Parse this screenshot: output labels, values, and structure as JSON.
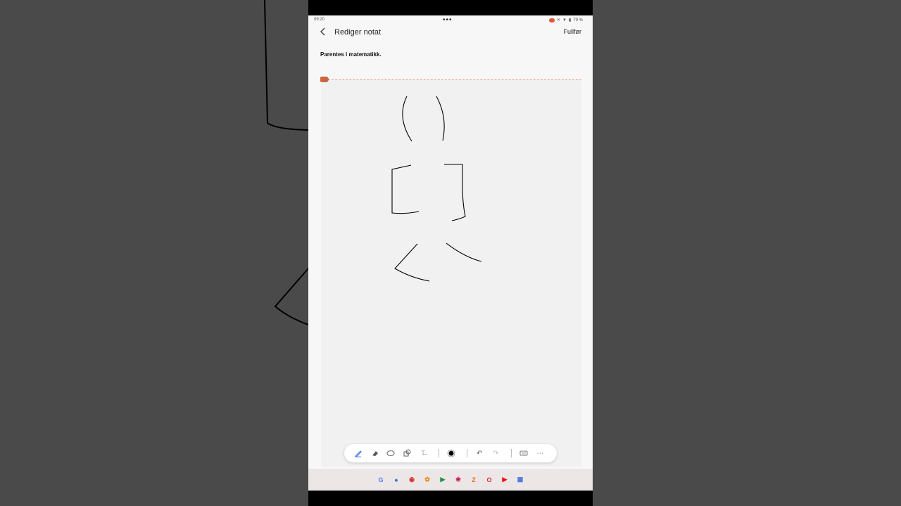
{
  "status": {
    "time": "09:20",
    "battery": "79 %"
  },
  "header": {
    "title": "Rediger notat",
    "done_label": "Fullfør"
  },
  "note": {
    "title": "Parentes i matematikk."
  },
  "toolbar": {
    "tools": [
      "pen-icon",
      "eraser-icon",
      "lasso-icon",
      "shapes-icon",
      "text-format-icon",
      "color-swatch",
      "undo-icon",
      "redo-icon",
      "keyboard-icon",
      "more-icon"
    ]
  },
  "dock": {
    "apps": [
      "google-icon",
      "messages-icon",
      "chrome-icon",
      "photos-icon",
      "play-store-icon",
      "gallery-icon",
      "notes-icon",
      "opera-icon",
      "youtube-icon",
      "app-drawer-icon"
    ]
  },
  "colors": {
    "accent": "#c9663f",
    "pen": "#000000",
    "screen_bg": "#f7f7f7",
    "outer_bg": "#4a4a4a"
  }
}
